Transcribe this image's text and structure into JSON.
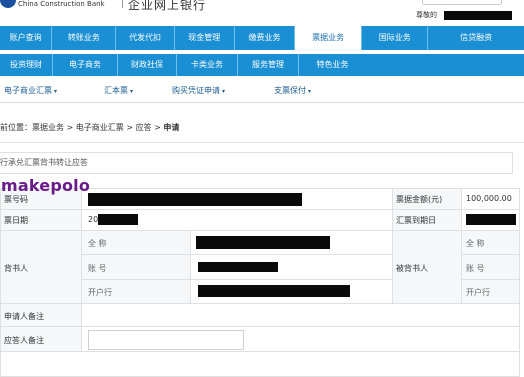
{
  "header": {
    "bank_name_en": "China Construction Bank",
    "bank_name_cn": "企业网上银行",
    "user_label": "尊敬的"
  },
  "nav_primary": [
    {
      "label": "账户查询",
      "active": false
    },
    {
      "label": "转账业务",
      "active": false
    },
    {
      "label": "代发代扣",
      "active": false
    },
    {
      "label": "现金管理",
      "active": false
    },
    {
      "label": "缴费业务",
      "active": false
    },
    {
      "label": "票据业务",
      "active": true
    },
    {
      "label": "国际业务",
      "active": false
    },
    {
      "label": "信贷融资",
      "active": false
    }
  ],
  "nav_secondary": [
    {
      "label": "投资理财"
    },
    {
      "label": "电子商务"
    },
    {
      "label": "财政社保"
    },
    {
      "label": "卡类业务"
    },
    {
      "label": "服务管理"
    },
    {
      "label": "特色业务"
    }
  ],
  "nav_tertiary": [
    {
      "label": "电子商业汇票"
    },
    {
      "label": "汇本票"
    },
    {
      "label": "购买凭证申请"
    },
    {
      "label": "支票保付"
    }
  ],
  "breadcrumb": {
    "prefix": "前位置：票据业务 > 电子商业汇票 > 应答 > ",
    "current": "申请"
  },
  "subtitle": "行承兑汇票背书转让应答",
  "watermark": "makepolo",
  "form": {
    "bill_number_label": "票号码",
    "bill_amount_label": "票据金额(元)",
    "bill_amount_value": "100,000.00",
    "issue_date_label": "票日期",
    "issue_date_value": "20",
    "due_date_label": "汇票到期日",
    "endorser_label": "背书人",
    "endorsee_label": "被背书人",
    "full_name_label": "全 称",
    "account_label": "账 号",
    "bank_label": "开户行",
    "applicant_note_label": "申请人备注",
    "responder_note_label": "应答人备注"
  },
  "colors": {
    "nav_blue": "#1b8fd3",
    "link_blue": "#1b5c93",
    "watermark_purple": "#6a1b8a"
  }
}
